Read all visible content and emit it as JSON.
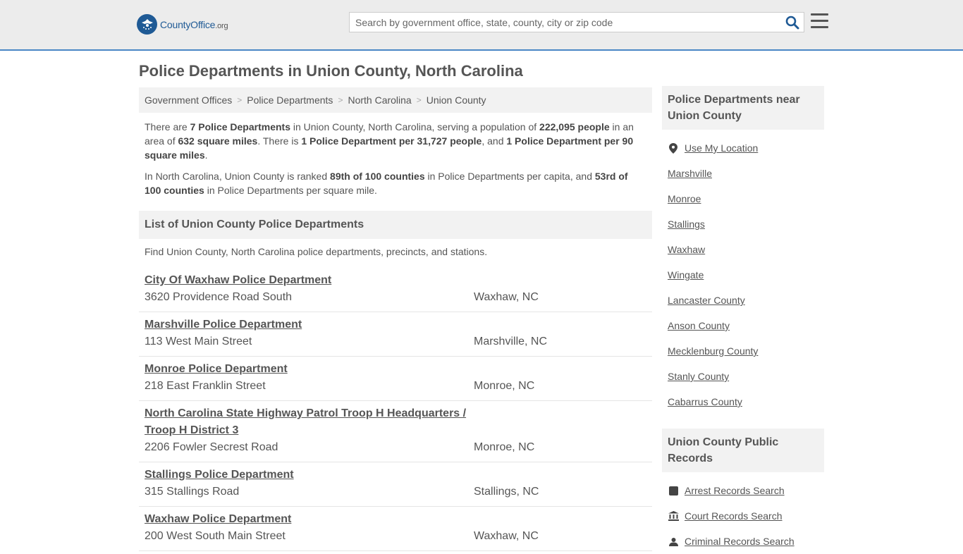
{
  "header": {
    "logo_main": "CountyOffice",
    "logo_tld": ".org",
    "search_placeholder": "Search by government office, state, county, city or zip code"
  },
  "page_title": "Police Departments in Union County, North Carolina",
  "breadcrumb": [
    "Government Offices",
    "Police Departments",
    "North Carolina",
    "Union County"
  ],
  "intro": {
    "p1": [
      {
        "t": "There are ",
        "b": false
      },
      {
        "t": "7 Police Departments",
        "b": true
      },
      {
        "t": " in Union County, North Carolina, serving a population of ",
        "b": false
      },
      {
        "t": "222,095 people",
        "b": true
      },
      {
        "t": " in an area of ",
        "b": false
      },
      {
        "t": "632 square miles",
        "b": true
      },
      {
        "t": ". There is ",
        "b": false
      },
      {
        "t": "1 Police Department per 31,727 people",
        "b": true
      },
      {
        "t": ", and ",
        "b": false
      },
      {
        "t": "1 Police Department per 90 square miles",
        "b": true
      },
      {
        "t": ".",
        "b": false
      }
    ],
    "p2": [
      {
        "t": "In North Carolina, Union County is ranked ",
        "b": false
      },
      {
        "t": "89th of 100 counties",
        "b": true
      },
      {
        "t": " in Police Departments per capita, and ",
        "b": false
      },
      {
        "t": "53rd of 100 counties",
        "b": true
      },
      {
        "t": " in Police Departments per square mile.",
        "b": false
      }
    ]
  },
  "list": {
    "heading": "List of Union County Police Departments",
    "description": "Find Union County, North Carolina police departments, precincts, and stations.",
    "items": [
      {
        "name": "City Of Waxhaw Police Department",
        "address": "3620 Providence Road South",
        "city": "Waxhaw, NC"
      },
      {
        "name": "Marshville Police Department",
        "address": "113 West Main Street",
        "city": "Marshville, NC"
      },
      {
        "name": "Monroe Police Department",
        "address": "218 East Franklin Street",
        "city": "Monroe, NC"
      },
      {
        "name": "North Carolina State Highway Patrol Troop H Headquarters / Troop H District 3",
        "address": "2206 Fowler Secrest Road",
        "city": "Monroe, NC"
      },
      {
        "name": "Stallings Police Department",
        "address": "315 Stallings Road",
        "city": "Stallings, NC"
      },
      {
        "name": "Waxhaw Police Department",
        "address": "200 West South Main Street",
        "city": "Waxhaw, NC"
      }
    ]
  },
  "sidebar": {
    "nearby": {
      "heading": "Police Departments near Union County",
      "use_location": "Use My Location",
      "links": [
        "Marshville",
        "Monroe",
        "Stallings",
        "Waxhaw",
        "Wingate",
        "Lancaster County",
        "Anson County",
        "Mecklenburg County",
        "Stanly County",
        "Cabarrus County"
      ]
    },
    "records": {
      "heading": "Union County Public Records",
      "links": [
        {
          "label": "Arrest Records Search",
          "icon": "arrest-icon"
        },
        {
          "label": "Court Records Search",
          "icon": "courthouse-icon"
        },
        {
          "label": "Criminal Records Search",
          "icon": "criminal-records-icon"
        }
      ]
    }
  },
  "colors": {
    "brand": "#1f5a95",
    "header_border": "#4a87c5"
  }
}
